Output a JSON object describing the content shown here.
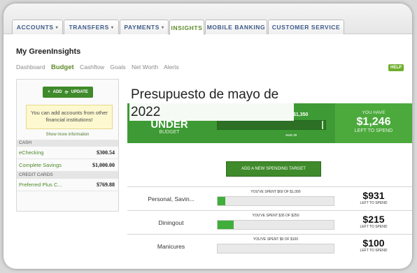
{
  "tabs": [
    {
      "label": "ACCOUNTS",
      "caret": "▾"
    },
    {
      "label": "TRANSFERS",
      "caret": "▾"
    },
    {
      "label": "PAYMENTS",
      "caret": "▾"
    },
    {
      "label": "INSIGHTS",
      "caret": ""
    },
    {
      "label": "MOBILE BANKING",
      "caret": ""
    },
    {
      "label": "CUSTOMER SERVICE",
      "caret": ""
    }
  ],
  "page_title": "My GreenInsights",
  "subnav": [
    "Dashboard",
    "Budget",
    "Cashflow",
    "Goals",
    "Net Worth",
    "Alerts"
  ],
  "help_label": "HELP",
  "sidebar": {
    "add_label": "ADD",
    "update_label": "UPDATE",
    "note": "You can add accounts from other financial institutions!",
    "show_more": "Show more information",
    "cash_header": "CASH",
    "credit_header": "CREDIT CARDS",
    "accounts": [
      {
        "name": "eChecking",
        "amount": "$300.54"
      },
      {
        "name": "Complete Savings",
        "amount": "$1,000.00"
      },
      {
        "name": "Preferred Plus C...",
        "amount": "$769.88"
      }
    ]
  },
  "overlay_title": "Presupuesto de mayo de 2022",
  "banner": {
    "status": "UNDER",
    "status_sub": "BUDGET",
    "bar_amount": "$1,350",
    "bar_date": "AUG 20",
    "bar_fill": 0.98,
    "you_have": "YOU HAVE",
    "have_amount": "$1,246",
    "have_sub": "LEFT TO SPEND",
    "colors": {
      "dark": "#3d9a34",
      "light": "#4caa3d"
    }
  },
  "add_target_label": "ADD A NEW SPENDING TARGET",
  "budgets": [
    {
      "category": "Personal, Savin...",
      "spent_text": "YOU'VE SPENT $69 OF $1,000",
      "fill": 0.069,
      "left_amount": "$931",
      "left_label": "LEFT TO SPEND"
    },
    {
      "category": "Diningout",
      "spent_text": "YOU'VE SPENT $35 OF $250",
      "fill": 0.14,
      "left_amount": "$215",
      "left_label": "LEFT TO SPEND"
    },
    {
      "category": "Manicures",
      "spent_text": "YOU'VE SPENT $0 OF $100",
      "fill": 0.0,
      "left_amount": "$100",
      "left_label": "LEFT TO SPEND"
    }
  ]
}
